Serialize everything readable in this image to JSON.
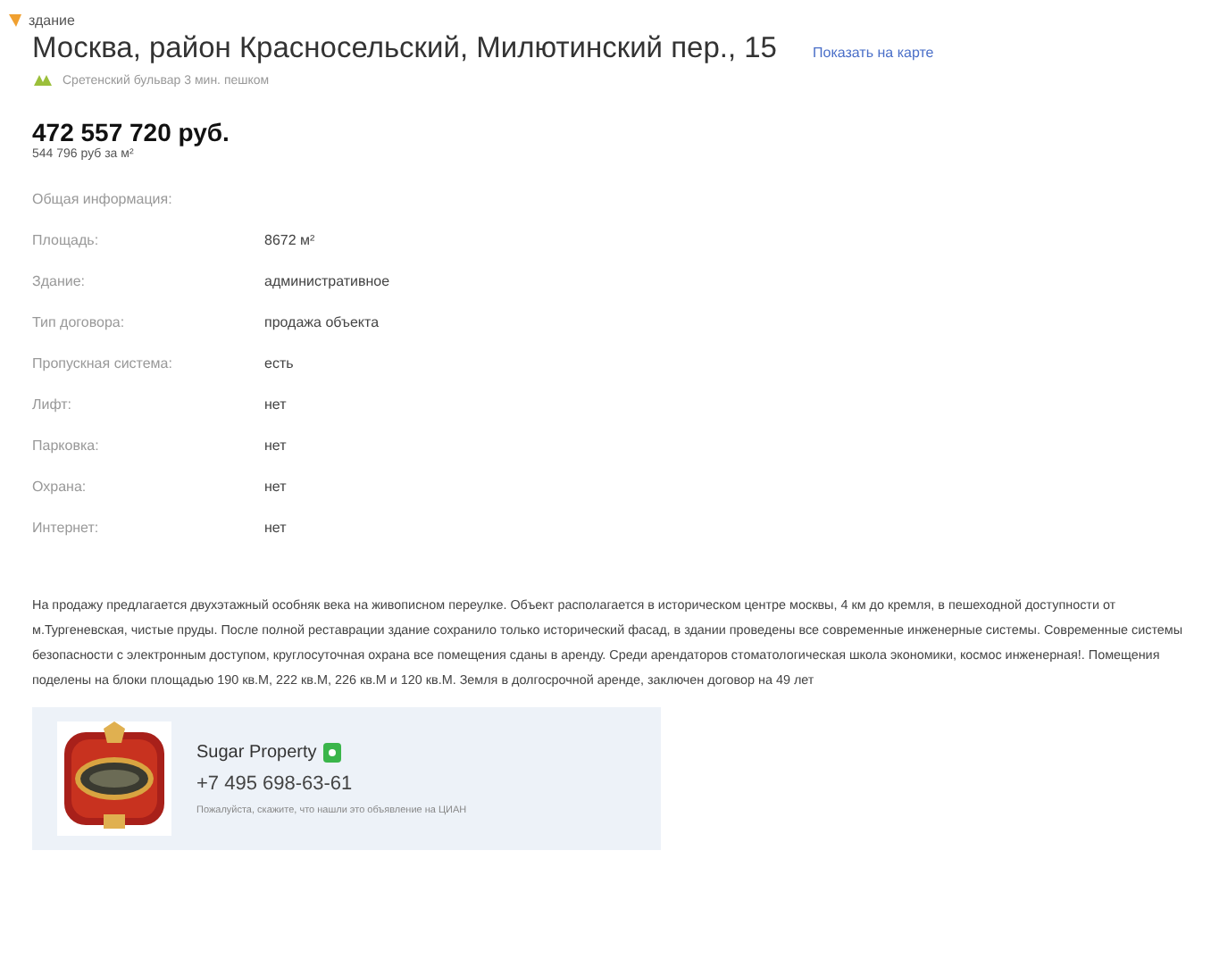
{
  "category": "здание",
  "address": "Москва, район Красносельский, Милютинский пер., 15",
  "map_link": "Показать на карте",
  "metro": "Сретенский бульвар 3 мин. пешком",
  "price": "472 557 720 руб.",
  "price_per_m2": "544 796 руб за м²",
  "info_heading": "Общая информация:",
  "info": [
    {
      "label": "Площадь:",
      "value": "8672 м²"
    },
    {
      "label": "Здание:",
      "value": "административное"
    },
    {
      "label": "Тип договора:",
      "value": "продажа объекта"
    },
    {
      "label": "Пропускная система:",
      "value": "есть"
    },
    {
      "label": "Лифт:",
      "value": "нет"
    },
    {
      "label": "Парковка:",
      "value": "нет"
    },
    {
      "label": "Охрана:",
      "value": "нет"
    },
    {
      "label": "Интернет:",
      "value": "нет"
    }
  ],
  "description": "На продажу предлагается двухэтажный особняк века на живописном переулке. Объект располагается в историческом центре москвы, 4 км до кремля, в пешеходной доступности от м.Тургеневская, чистые пруды. После полной реставрации здание сохранило только исторический фасад, в здании проведены все современные инженерные системы. Современные системы безопасности с электронным доступом, круглосуточная охрана все помещения сданы в аренду. Среди арендаторов стоматологическая школа экономики, космос инженерная!. Помещения поделены на блоки площадью 190 кв.М, 222 кв.М, 226 кв.М и 120 кв.М. Земля в долгосрочной аренде, заключен договор на 49 лет",
  "agent": {
    "name": "Sugar Property",
    "verified": true,
    "phone": "+7 495 698-63-61",
    "note": "Пожалуйста, скажите, что нашли это объявление на ЦИАН"
  }
}
